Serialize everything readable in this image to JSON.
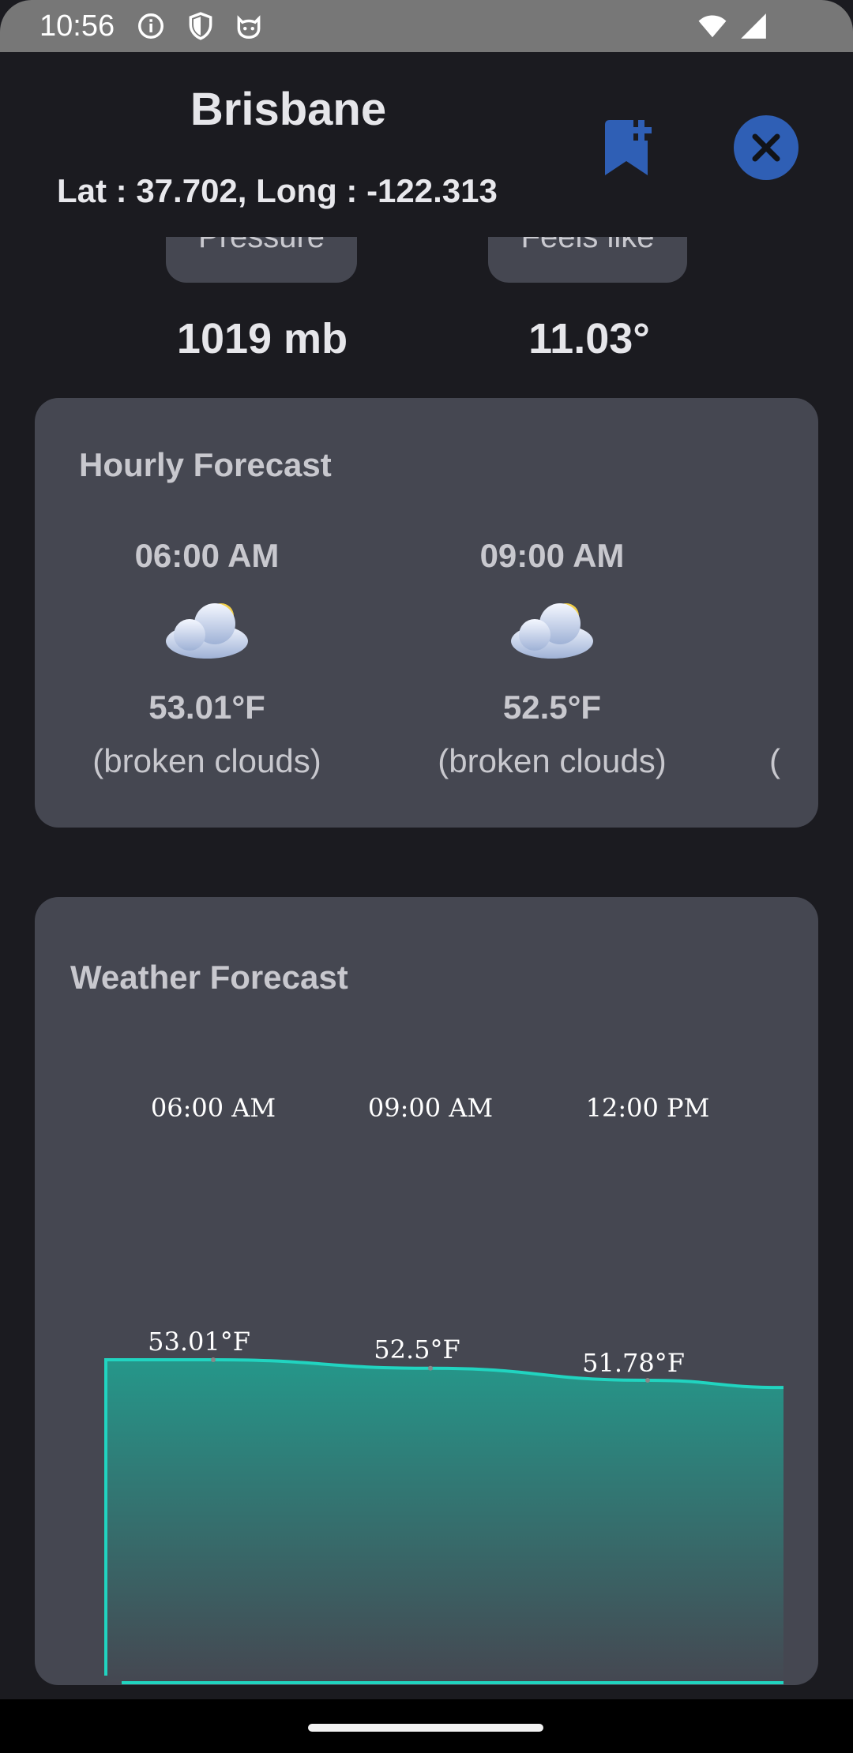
{
  "status_bar": {
    "time": "10:56",
    "icons": [
      "info-circle-icon",
      "shield-icon",
      "cat-face-icon",
      "wifi-icon",
      "signal-icon"
    ]
  },
  "header": {
    "city": "Brisbane",
    "coords": "Lat : 37.702, Long : -122.313",
    "bookmark_icon": "bookmark-add-icon",
    "close_icon": "close-icon",
    "accent_color": "#2f5fb5"
  },
  "info": {
    "pressure_label": "Pressure",
    "pressure_value": "1019 mb",
    "feels_like_label": "Feels like",
    "feels_like_value": "11.03°"
  },
  "hourly": {
    "title": "Hourly Forecast",
    "items": [
      {
        "time": "06:00 AM",
        "icon": "broken-clouds-icon",
        "temp": "53.01°F",
        "desc": "(broken clouds)"
      },
      {
        "time": "09:00 AM",
        "icon": "broken-clouds-icon",
        "temp": "52.5°F",
        "desc": "(broken clouds)"
      },
      {
        "time": "",
        "icon": "",
        "temp": "",
        "desc": "("
      }
    ]
  },
  "forecast": {
    "title": "Weather Forecast"
  },
  "chart_data": {
    "type": "area",
    "categories": [
      "06:00 AM",
      "09:00 AM",
      "12:00 PM"
    ],
    "values": [
      53.01,
      52.5,
      51.78
    ],
    "value_labels": [
      "53.01°F",
      "52.5°F",
      "51.78°F"
    ],
    "line_color": "#21d4c0",
    "fill_color": "#2a8a80"
  }
}
